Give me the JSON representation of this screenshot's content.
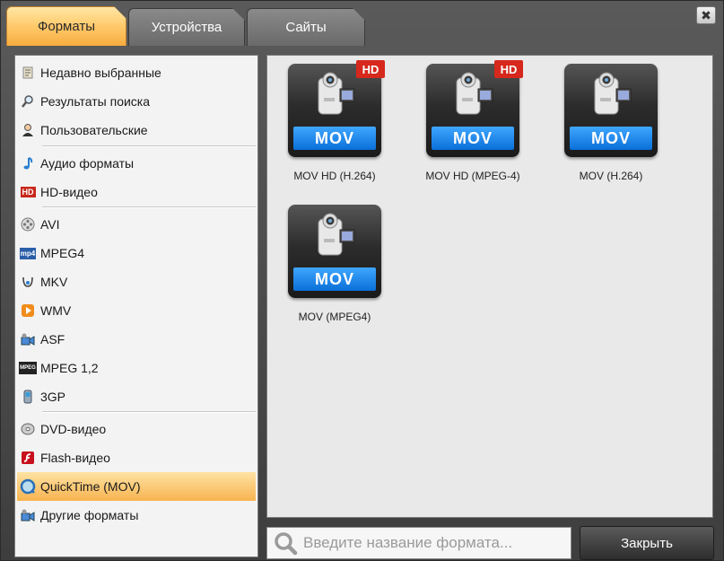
{
  "tabs": [
    {
      "label": "Форматы",
      "active": true
    },
    {
      "label": "Устройства",
      "active": false
    },
    {
      "label": "Сайты",
      "active": false
    }
  ],
  "window": {
    "close_glyph": "✖"
  },
  "sidebar": {
    "items": [
      {
        "label": "Недавно выбранные",
        "icon": "recent-icon"
      },
      {
        "label": "Результаты поиска",
        "icon": "search-icon"
      },
      {
        "label": "Пользовательские",
        "icon": "user-icon"
      },
      {
        "label": "Аудио форматы",
        "icon": "music-note-icon"
      },
      {
        "label": "HD-видео",
        "icon": "hd-icon"
      },
      {
        "label": "AVI",
        "icon": "film-reel-icon"
      },
      {
        "label": "MPEG4",
        "icon": "mp4-icon"
      },
      {
        "label": "MKV",
        "icon": "mkv-icon"
      },
      {
        "label": "WMV",
        "icon": "wmv-play-icon"
      },
      {
        "label": "ASF",
        "icon": "asf-icon"
      },
      {
        "label": "MPEG 1,2",
        "icon": "mpeg-icon"
      },
      {
        "label": "3GP",
        "icon": "phone-icon"
      },
      {
        "label": "DVD-видео",
        "icon": "dvd-icon"
      },
      {
        "label": "Flash-видео",
        "icon": "flash-icon"
      },
      {
        "label": "QuickTime (MOV)",
        "icon": "quicktime-icon",
        "selected": true
      },
      {
        "label": "Другие форматы",
        "icon": "other-formats-icon"
      }
    ]
  },
  "formats": [
    {
      "label": "MOV HD (H.264)",
      "badge": "MOV",
      "hd": "HD"
    },
    {
      "label": "MOV HD (MPEG-4)",
      "badge": "MOV",
      "hd": "HD"
    },
    {
      "label": "MOV (H.264)",
      "badge": "MOV",
      "hd": null
    },
    {
      "label": "MOV (MPEG4)",
      "badge": "MOV",
      "hd": null
    }
  ],
  "search": {
    "placeholder": "Введите название формата..."
  },
  "buttons": {
    "close_label": "Закрыть"
  },
  "icon_mini": {
    "hd": "HD",
    "mp4": "mp4",
    "mpeg": "MPEG"
  },
  "colors": {
    "accent": "#f7ac3e",
    "mov_blue": "#0a6fd8",
    "hd_red": "#d6281c"
  }
}
